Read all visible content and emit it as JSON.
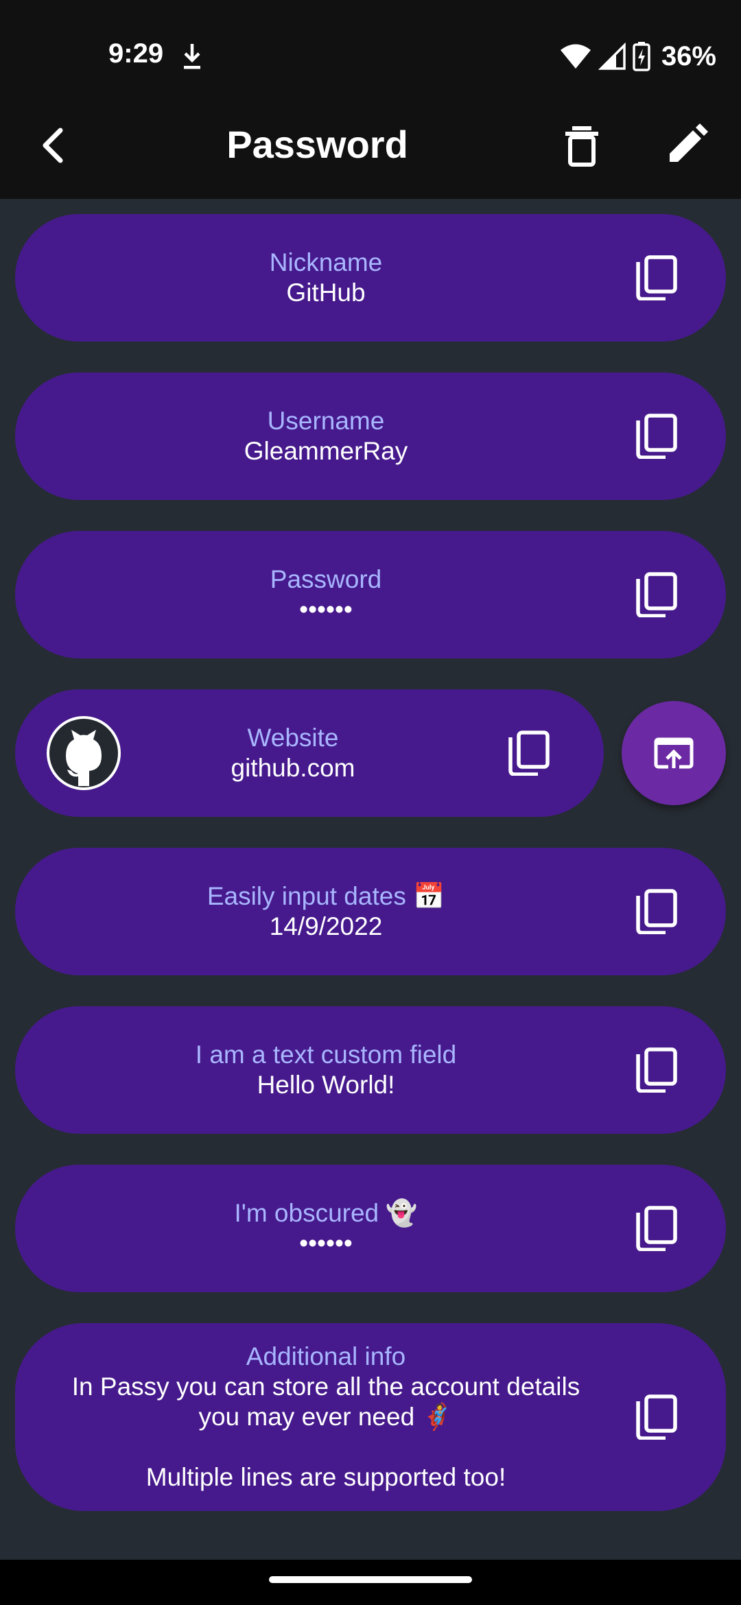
{
  "status": {
    "time": "9:29",
    "battery": "36%",
    "icons": [
      "download-icon",
      "wifi-icon",
      "cellular-signal-icon",
      "battery-charging-icon"
    ]
  },
  "app_bar": {
    "title": "Password",
    "icons": [
      "back-arrow-icon",
      "delete-icon",
      "edit-icon"
    ]
  },
  "fields": {
    "nickname": {
      "label": "Nickname",
      "value": "GitHub"
    },
    "username": {
      "label": "Username",
      "value": "GleammerRay"
    },
    "password": {
      "label": "Password",
      "value": "••••••"
    },
    "website": {
      "label": "Website",
      "value": "github.com"
    },
    "date": {
      "label": "Easily input dates 📅",
      "value": "14/9/2022"
    },
    "text_custom": {
      "label": "I am a text custom field",
      "value": "Hello World!"
    },
    "obscured": {
      "label": "I'm obscured 👻",
      "value": "••••••"
    },
    "additional_info": {
      "label": "Additional info",
      "value": "In Passy you can store all the account details\nyou may ever need 🦸\n\nMultiple lines are supported too!"
    }
  },
  "icons": {
    "copy": "copy-icon",
    "website_logo": "github-logo-icon",
    "open_url": "open-in-browser-icon"
  },
  "colors": {
    "background": "#262c33",
    "bar": "#111111",
    "card": "#461a8c",
    "label": "#a9b6ff",
    "fab": "#6b2aa3"
  }
}
